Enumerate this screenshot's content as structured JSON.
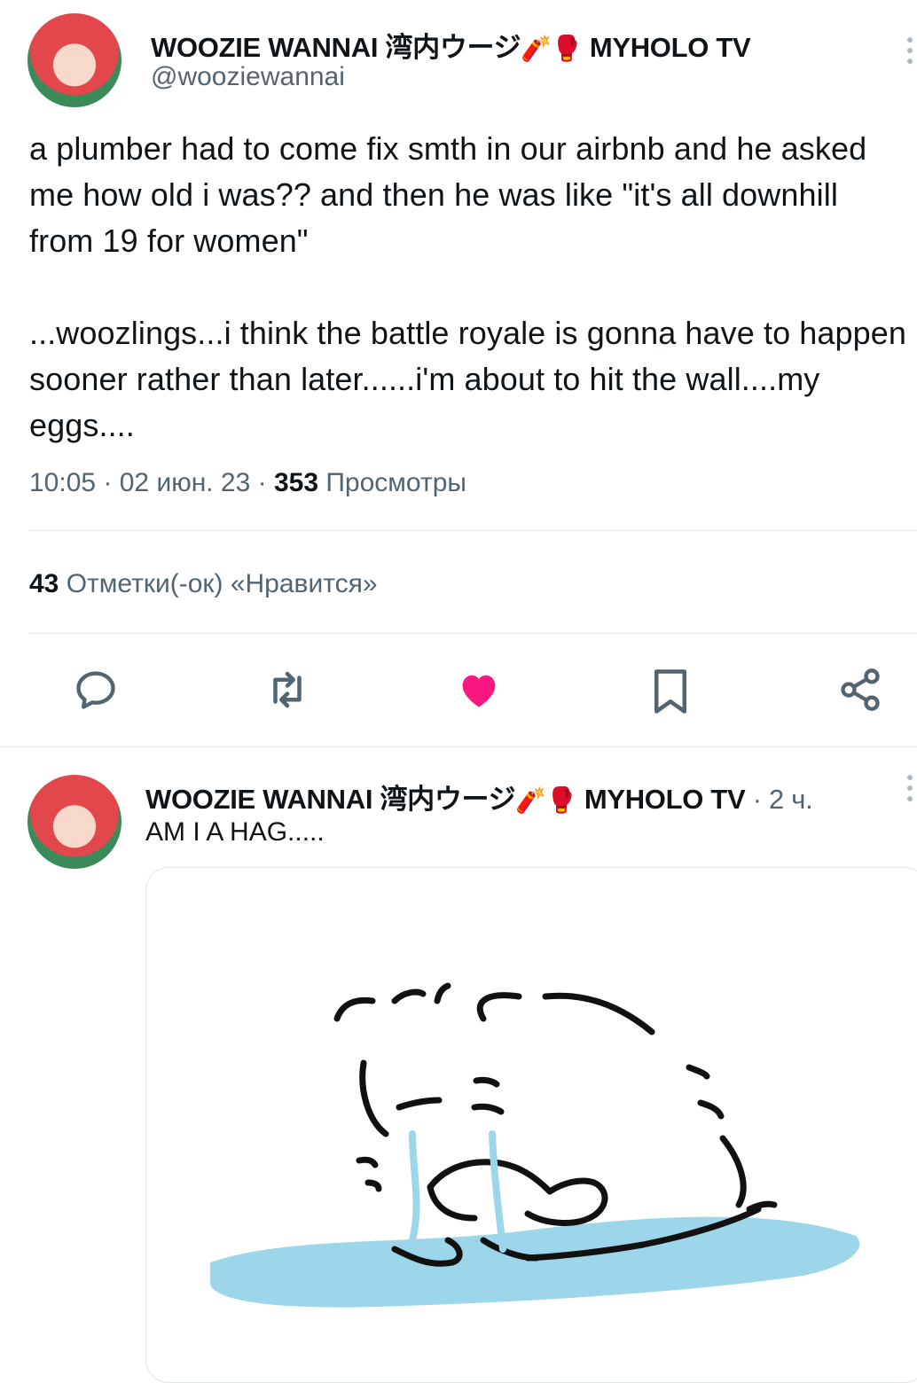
{
  "tweet": {
    "display_name": "WOOZIE WANNAI 湾内ウージ",
    "emoji_firecracker": "🧨",
    "emoji_glove": "🥊",
    "display_name_suffix": "MYHOLO TV",
    "handle": "@wooziewannai",
    "text": "a plumber had to come fix smth in our airbnb and he asked me how old i was?? and then he was like \"it's all downhill from 19 for women\"\n\n...woozlings...i think the battle royale is gonna have to happen sooner rather than later......i'm about to hit the wall....my eggs....",
    "time": "10:05 · 02 июн. 23 · ",
    "views_count": "353",
    "views_label": " Просмотры",
    "likes_count": "43",
    "likes_label": " Отметки(-ок) «Нравится»",
    "like_color": "#f91880"
  },
  "actions": {
    "reply_icon": "reply-icon",
    "retweet_icon": "retweet-icon",
    "like_icon": "heart-filled-icon",
    "bookmark_icon": "bookmark-icon",
    "share_icon": "share-icon"
  },
  "reply": {
    "display_name": "WOOZIE WANNAI 湾内ウージ",
    "emoji_firecracker": "🧨",
    "emoji_glove": "🥊",
    "display_name_suffix": "MYHOLO TV",
    "time": " · 2 ч.",
    "text": "AM I A HAG....."
  },
  "colors": {
    "text": "#0f1419",
    "secondary": "#536471",
    "tear": "#9dd6ea"
  }
}
